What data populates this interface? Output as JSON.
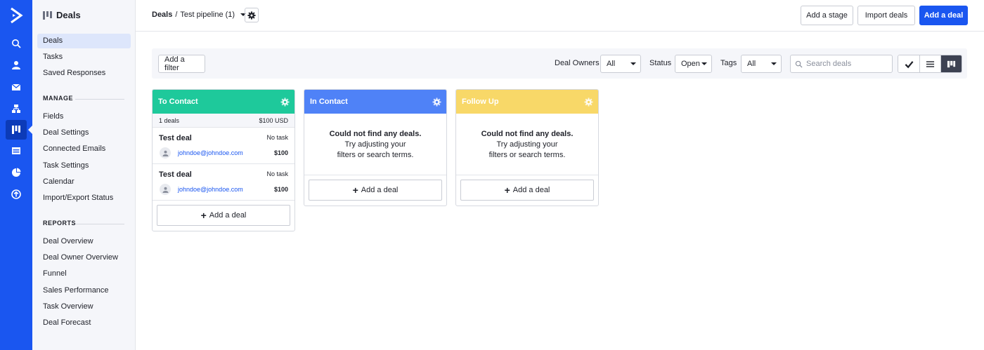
{
  "nav": {
    "section_title": "Deals",
    "items": [
      {
        "label": "Deals"
      },
      {
        "label": "Tasks"
      },
      {
        "label": "Saved Responses"
      }
    ],
    "manage_title": "MANAGE",
    "manage_items": [
      {
        "label": "Fields"
      },
      {
        "label": "Deal Settings"
      },
      {
        "label": "Connected Emails"
      },
      {
        "label": "Task Settings"
      },
      {
        "label": "Calendar"
      },
      {
        "label": "Import/Export Status"
      }
    ],
    "reports_title": "REPORTS",
    "reports_items": [
      {
        "label": "Deal Overview"
      },
      {
        "label": "Deal Owner Overview"
      },
      {
        "label": "Funnel"
      },
      {
        "label": "Sales Performance"
      },
      {
        "label": "Task Overview"
      },
      {
        "label": "Deal Forecast"
      }
    ]
  },
  "header": {
    "crumb_root": "Deals",
    "crumb_sep": "/",
    "pipeline": "Test pipeline (1)",
    "add_stage": "Add a stage",
    "import_deals": "Import deals",
    "add_deal": "Add a deal"
  },
  "filters": {
    "add_filter": "Add a filter",
    "owners_label": "Deal Owners",
    "owners_value": "All",
    "status_label": "Status",
    "status_value": "Open",
    "tags_label": "Tags",
    "tags_value": "All",
    "search_placeholder": "Search deals"
  },
  "stages": [
    {
      "name": "To Contact",
      "color": "#1ec99b",
      "count": "1 deals",
      "total": "$100 USD",
      "deals": [
        {
          "title": "Test deal",
          "task": "No task",
          "email": "johndoe@johndoe.com",
          "amount": "$100"
        },
        {
          "title": "Test deal",
          "task": "No task",
          "email": "johndoe@johndoe.com",
          "amount": "$100"
        }
      ],
      "add_label": "Add a deal"
    },
    {
      "name": "In Contact",
      "color": "#4f82f7",
      "empty_title": "Could not find any deals.",
      "empty_line1": "Try adjusting your",
      "empty_line2": "filters or search terms.",
      "add_label": "Add a deal"
    },
    {
      "name": "Follow Up",
      "color": "#f8d868",
      "empty_title": "Could not find any deals.",
      "empty_line1": "Try adjusting your",
      "empty_line2": "filters or search terms.",
      "add_label": "Add a deal"
    }
  ],
  "colors": {
    "rail": "#1a56f0",
    "primary": "#1a56f0"
  }
}
